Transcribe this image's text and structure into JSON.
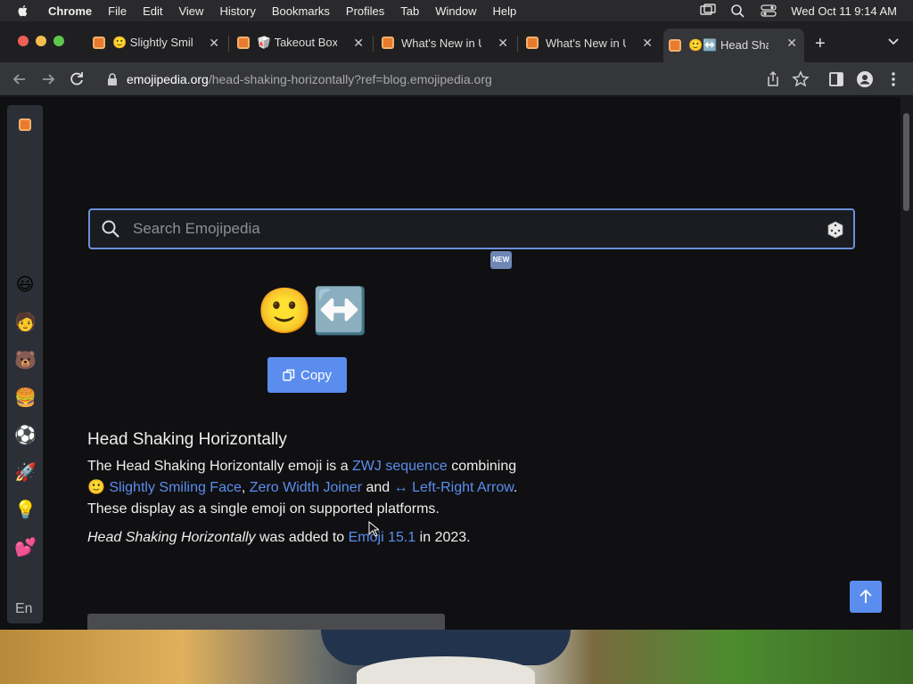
{
  "menubar": {
    "app": "Chrome",
    "items": [
      "File",
      "Edit",
      "View",
      "History",
      "Bookmarks",
      "Profiles",
      "Tab",
      "Window",
      "Help"
    ],
    "datetime": "Wed Oct 11  9:14 AM"
  },
  "tabs": [
    {
      "label": "🙂 Slightly Smili",
      "active": false
    },
    {
      "label": "🥡 Takeout Box I",
      "active": false
    },
    {
      "label": "What's New in U",
      "active": false
    },
    {
      "label": "What's New in U",
      "active": false
    },
    {
      "label": "🙂↔️ Head Shak",
      "active": true
    }
  ],
  "omnibox": {
    "host": "emojipedia.org",
    "path": "/head-shaking-horizontally?ref=blog.emojipedia.org"
  },
  "sidebar": {
    "items": [
      "😃",
      "🧑",
      "🐻",
      "🍔",
      "⚽",
      "🚀",
      "💡",
      "💕"
    ],
    "lang": "En"
  },
  "search": {
    "placeholder": "Search Emojipedia"
  },
  "badge": "NEW",
  "emoji": {
    "glyph": "🙂↔️",
    "copy_label": "Copy"
  },
  "article": {
    "title": "Head Shaking Horizontally",
    "p1_text1": "The Head Shaking Horizontally emoji is a ",
    "p1_link1": "ZWJ sequence",
    "p1_text2": " combining ",
    "p1_emoji1": "🙂",
    "p1_link2": "Slightly Smiling Face",
    "p1_text3": ", ",
    "p1_link3": "Zero Width Joiner",
    "p1_text4": " and ",
    "p1_link4": "↔ Left-Right Arrow",
    "p1_text5": ". These display as a single emoji on supported platforms.",
    "p2_em": "Head Shaking Horizontally",
    "p2_text1": " was added to ",
    "p2_link": "Emoji 15.1",
    "p2_text2": " in 2023."
  }
}
